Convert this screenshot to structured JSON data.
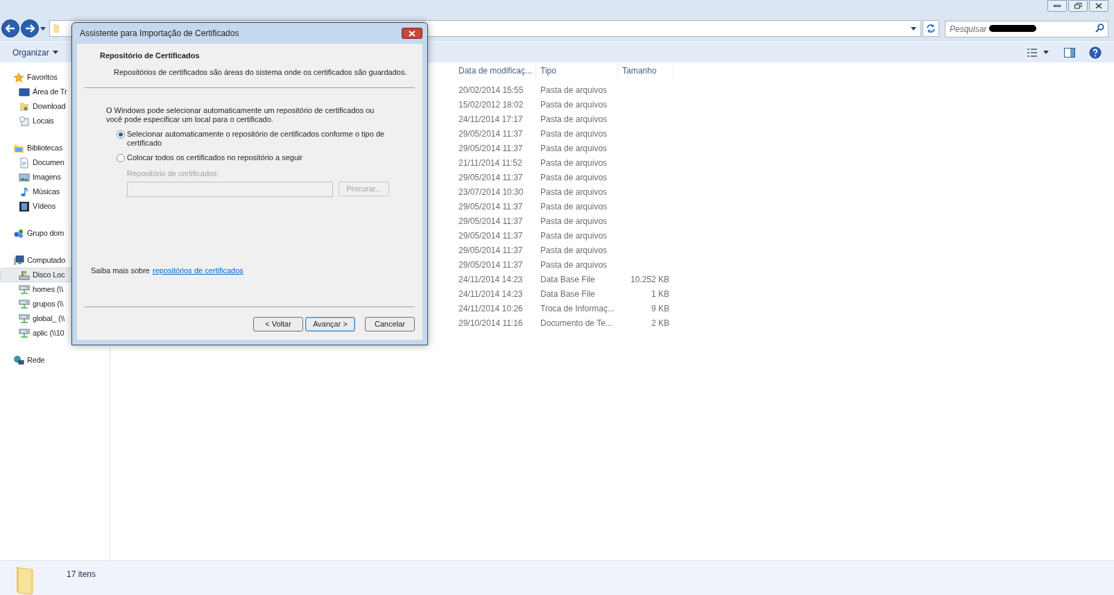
{
  "search": {
    "placeholder": "Pesquisar"
  },
  "toolbar": {
    "organize": "Organizar"
  },
  "sidebar": {
    "groups": [
      {
        "label": "Favoritos",
        "kind": "favorites",
        "selected": false,
        "children": [
          {
            "label": "Área de Tr",
            "kind": "desktop",
            "selected": false
          },
          {
            "label": "Download",
            "kind": "downloads",
            "selected": false
          },
          {
            "label": "Locais",
            "kind": "places",
            "selected": false
          }
        ]
      },
      {
        "label": "Bibliotecas",
        "kind": "library",
        "selected": false,
        "children": [
          {
            "label": "Documen",
            "kind": "documents",
            "selected": false
          },
          {
            "label": "Imagens",
            "kind": "pictures",
            "selected": false
          },
          {
            "label": "Músicas",
            "kind": "music",
            "selected": false
          },
          {
            "label": "Vídeos",
            "kind": "videos",
            "selected": false
          }
        ]
      },
      {
        "label": "Grupo dom",
        "kind": "homegroup",
        "selected": false
      },
      {
        "label": "Computado",
        "kind": "computer",
        "selected": false,
        "children": [
          {
            "label": "Disco Loc",
            "kind": "drive",
            "selected": true
          },
          {
            "label": "homes (\\\\",
            "kind": "network-drive",
            "selected": false
          },
          {
            "label": "grupos (\\\\",
            "kind": "network-drive",
            "selected": false
          },
          {
            "label": "global_ (\\\\",
            "kind": "network-drive",
            "selected": false
          },
          {
            "label": "aplic (\\\\10",
            "kind": "network-drive",
            "selected": false
          }
        ]
      },
      {
        "label": "Rede",
        "kind": "network",
        "selected": false
      }
    ]
  },
  "table": {
    "columns": [
      "Data de modificaç...",
      "Tipo",
      "Tamanho"
    ],
    "rows": [
      {
        "modified": "20/02/2014 15:55",
        "type": "Pasta de arquivos"
      },
      {
        "modified": "15/02/2012 18:02",
        "type": "Pasta de arquivos"
      },
      {
        "modified": "24/11/2014 17:17",
        "type": "Pasta de arquivos"
      },
      {
        "modified": "29/05/2014 11:37",
        "type": "Pasta de arquivos"
      },
      {
        "modified": "29/05/2014 11:37",
        "type": "Pasta de arquivos"
      },
      {
        "modified": "21/11/2014 11:52",
        "type": "Pasta de arquivos"
      },
      {
        "modified": "29/05/2014 11:37",
        "type": "Pasta de arquivos"
      },
      {
        "modified": "23/07/2014 10:30",
        "type": "Pasta de arquivos"
      },
      {
        "modified": "29/05/2014 11:37",
        "type": "Pasta de arquivos"
      },
      {
        "modified": "29/05/2014 11:37",
        "type": "Pasta de arquivos"
      },
      {
        "modified": "29/05/2014 11:37",
        "type": "Pasta de arquivos"
      },
      {
        "modified": "29/05/2014 11:37",
        "type": "Pasta de arquivos"
      },
      {
        "modified": "29/05/2014 11:37",
        "type": "Pasta de arquivos"
      },
      {
        "modified": "24/11/2014 14:23",
        "type": "Data Base File",
        "size": "10.252 KB"
      },
      {
        "modified": "24/11/2014 14:23",
        "type": "Data Base File",
        "size": "1 KB"
      },
      {
        "modified": "24/11/2014 10:26",
        "type": "Troca de Informaç...",
        "size": "9 KB"
      },
      {
        "modified": "29/10/2014 11:16",
        "type": "Documento de Te...",
        "size": "2 KB"
      }
    ]
  },
  "status_bar": {
    "count": "17 itens"
  },
  "dialog": {
    "title": "Assistente para Importação de Certificados",
    "heading": "Repositório de Certificados",
    "subheading": "Repositórios de certificados são áreas do sistema onde os certificados são guardados.",
    "intro": "O Windows pode selecionar automaticamente um repositório de certificados ou você pode especificar um local para o certificado.",
    "options": [
      {
        "label": "Selecionar automaticamente o repositório de certificados conforme o tipo de certificado",
        "selected": true
      },
      {
        "label": "Colocar todos os certificados no repositório a seguir",
        "selected": false
      }
    ],
    "store_label": "Repositório de certificados:",
    "store_field": {
      "disabled": true
    },
    "browse_button": {
      "label": "Procurar...",
      "disabled": true
    },
    "learn_more": "Saiba mais sobre",
    "learn_more_link": "repositórios de certificados",
    "buttons": [
      {
        "label": "< Voltar",
        "default": false
      },
      {
        "label": "Avançar >",
        "default": true
      },
      {
        "label": "Cancelar",
        "default": false
      }
    ]
  }
}
